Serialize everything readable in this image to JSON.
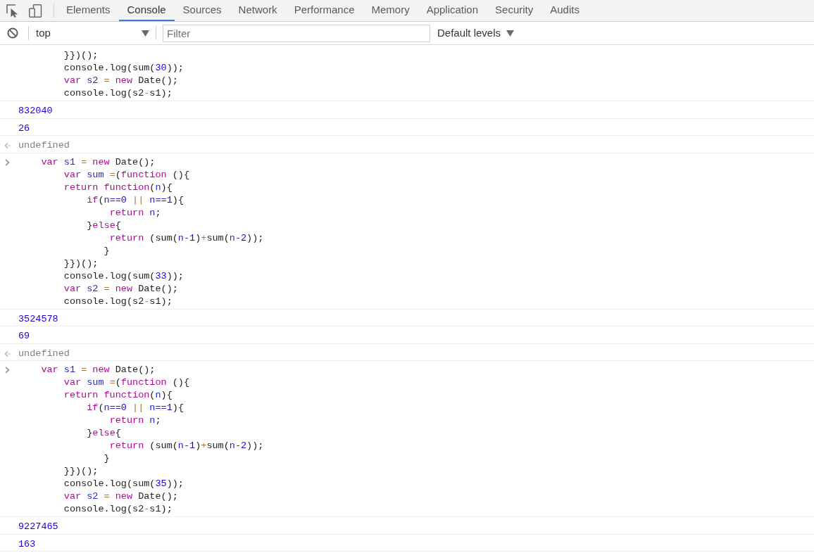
{
  "tabs": [
    {
      "label": "Elements",
      "selected": false
    },
    {
      "label": "Console",
      "selected": true
    },
    {
      "label": "Sources",
      "selected": false
    },
    {
      "label": "Network",
      "selected": false
    },
    {
      "label": "Performance",
      "selected": false
    },
    {
      "label": "Memory",
      "selected": false
    },
    {
      "label": "Application",
      "selected": false
    },
    {
      "label": "Security",
      "selected": false
    },
    {
      "label": "Audits",
      "selected": false
    }
  ],
  "console_toolbar": {
    "context": "top",
    "filter": {
      "placeholder": "Filter"
    },
    "levels": "Default levels"
  },
  "messages": [
    {
      "kind": "continuation",
      "lines": [
        {
          "tokens": [
            {
              "kind": "plain",
              "text": "        }})();"
            }
          ]
        },
        {
          "tokens": [
            {
              "kind": "plain",
              "text": "        console.log(sum("
            },
            {
              "kind": "number",
              "text": "30"
            },
            {
              "kind": "plain",
              "text": "));"
            }
          ]
        },
        {
          "tokens": [
            {
              "kind": "keyword",
              "text": "        var "
            },
            {
              "kind": "name",
              "text": "s2 "
            },
            {
              "kind": "operator",
              "text": "= "
            },
            {
              "kind": "keyword",
              "text": "new "
            },
            {
              "kind": "plain",
              "text": "Date();"
            }
          ]
        },
        {
          "tokens": [
            {
              "kind": "plain",
              "text": "        console.log(s2"
            },
            {
              "kind": "operator",
              "text": "-"
            },
            {
              "kind": "plain",
              "text": "s1);"
            }
          ]
        }
      ]
    },
    {
      "kind": "output",
      "text": "832040"
    },
    {
      "kind": "output",
      "text": "26"
    },
    {
      "kind": "result",
      "text": "undefined"
    },
    {
      "kind": "input",
      "lines": [
        {
          "tokens": [
            {
              "kind": "keyword",
              "text": "    var "
            },
            {
              "kind": "name",
              "text": "s1 "
            },
            {
              "kind": "operator",
              "text": "= "
            },
            {
              "kind": "keyword",
              "text": "new "
            },
            {
              "kind": "plain",
              "text": "Date();"
            }
          ]
        },
        {
          "tokens": [
            {
              "kind": "keyword",
              "text": "        var "
            },
            {
              "kind": "name",
              "text": "sum "
            },
            {
              "kind": "operator",
              "text": "="
            },
            {
              "kind": "plain",
              "text": "("
            },
            {
              "kind": "keyword",
              "text": "function "
            },
            {
              "kind": "plain",
              "text": "(){"
            }
          ]
        },
        {
          "tokens": [
            {
              "kind": "keyword",
              "text": "        return function"
            },
            {
              "kind": "plain",
              "text": "("
            },
            {
              "kind": "name",
              "text": "n"
            },
            {
              "kind": "plain",
              "text": "){"
            }
          ]
        },
        {
          "tokens": [
            {
              "kind": "keyword",
              "text": "            if"
            },
            {
              "kind": "plain",
              "text": "("
            },
            {
              "kind": "name",
              "text": "n=="
            },
            {
              "kind": "number",
              "text": "0"
            },
            {
              "kind": "operator",
              "text": " || "
            },
            {
              "kind": "name",
              "text": "n=="
            },
            {
              "kind": "number",
              "text": "1"
            },
            {
              "kind": "plain",
              "text": "){"
            }
          ]
        },
        {
          "tokens": [
            {
              "kind": "keyword",
              "text": "                return "
            },
            {
              "kind": "name",
              "text": "n"
            },
            {
              "kind": "plain",
              "text": ";"
            }
          ]
        },
        {
          "tokens": [
            {
              "kind": "plain",
              "text": "            }"
            },
            {
              "kind": "keyword",
              "text": "else"
            },
            {
              "kind": "plain",
              "text": "{"
            }
          ]
        },
        {
          "tokens": [
            {
              "kind": "keyword",
              "text": "                return "
            },
            {
              "kind": "plain",
              "text": "(sum("
            },
            {
              "kind": "name",
              "text": "n-"
            },
            {
              "kind": "number",
              "text": "1"
            },
            {
              "kind": "plain",
              "text": ")"
            },
            {
              "kind": "operator",
              "text": "+"
            },
            {
              "kind": "plain",
              "text": "sum("
            },
            {
              "kind": "name",
              "text": "n-"
            },
            {
              "kind": "number",
              "text": "2"
            },
            {
              "kind": "plain",
              "text": "));"
            }
          ]
        },
        {
          "tokens": [
            {
              "kind": "plain",
              "text": "               }"
            }
          ]
        },
        {
          "tokens": [
            {
              "kind": "plain",
              "text": "        }})();"
            }
          ]
        },
        {
          "tokens": [
            {
              "kind": "plain",
              "text": "        console.log(sum("
            },
            {
              "kind": "number",
              "text": "33"
            },
            {
              "kind": "plain",
              "text": "));"
            }
          ]
        },
        {
          "tokens": [
            {
              "kind": "keyword",
              "text": "        var "
            },
            {
              "kind": "name",
              "text": "s2 "
            },
            {
              "kind": "operator",
              "text": "= "
            },
            {
              "kind": "keyword",
              "text": "new "
            },
            {
              "kind": "plain",
              "text": "Date();"
            }
          ]
        },
        {
          "tokens": [
            {
              "kind": "plain",
              "text": "        console.log(s2"
            },
            {
              "kind": "operator",
              "text": "-"
            },
            {
              "kind": "plain",
              "text": "s1);"
            }
          ]
        }
      ]
    },
    {
      "kind": "output",
      "text": "3524578"
    },
    {
      "kind": "output",
      "text": "69"
    },
    {
      "kind": "result",
      "text": "undefined"
    },
    {
      "kind": "input",
      "lines": [
        {
          "tokens": [
            {
              "kind": "keyword",
              "text": "    var "
            },
            {
              "kind": "name",
              "text": "s1 "
            },
            {
              "kind": "operator",
              "text": "= "
            },
            {
              "kind": "keyword",
              "text": "new "
            },
            {
              "kind": "plain",
              "text": "Date();"
            }
          ]
        },
        {
          "tokens": [
            {
              "kind": "keyword",
              "text": "        var "
            },
            {
              "kind": "name",
              "text": "sum "
            },
            {
              "kind": "operator",
              "text": "="
            },
            {
              "kind": "plain",
              "text": "("
            },
            {
              "kind": "keyword",
              "text": "function "
            },
            {
              "kind": "plain",
              "text": "(){"
            }
          ]
        },
        {
          "tokens": [
            {
              "kind": "keyword",
              "text": "        return function"
            },
            {
              "kind": "plain",
              "text": "("
            },
            {
              "kind": "name",
              "text": "n"
            },
            {
              "kind": "plain",
              "text": "){"
            }
          ]
        },
        {
          "tokens": [
            {
              "kind": "keyword",
              "text": "            if"
            },
            {
              "kind": "plain",
              "text": "("
            },
            {
              "kind": "name",
              "text": "n=="
            },
            {
              "kind": "number",
              "text": "0"
            },
            {
              "kind": "operator",
              "text": " || "
            },
            {
              "kind": "name",
              "text": "n=="
            },
            {
              "kind": "number",
              "text": "1"
            },
            {
              "kind": "plain",
              "text": "){"
            }
          ]
        },
        {
          "tokens": [
            {
              "kind": "keyword",
              "text": "                return "
            },
            {
              "kind": "name",
              "text": "n"
            },
            {
              "kind": "plain",
              "text": ";"
            }
          ]
        },
        {
          "tokens": [
            {
              "kind": "plain",
              "text": "            }"
            },
            {
              "kind": "keyword",
              "text": "else"
            },
            {
              "kind": "plain",
              "text": "{"
            }
          ]
        },
        {
          "tokens": [
            {
              "kind": "keyword",
              "text": "                return "
            },
            {
              "kind": "plain",
              "text": "(sum("
            },
            {
              "kind": "name",
              "text": "n-"
            },
            {
              "kind": "number",
              "text": "1"
            },
            {
              "kind": "plain",
              "text": ")"
            },
            {
              "kind": "operator",
              "text": "+"
            },
            {
              "kind": "plain",
              "text": "sum("
            },
            {
              "kind": "name",
              "text": "n-"
            },
            {
              "kind": "number",
              "text": "2"
            },
            {
              "kind": "plain",
              "text": "));"
            }
          ]
        },
        {
          "tokens": [
            {
              "kind": "plain",
              "text": "               }"
            }
          ]
        },
        {
          "tokens": [
            {
              "kind": "plain",
              "text": "        }})();"
            }
          ]
        },
        {
          "tokens": [
            {
              "kind": "plain",
              "text": "        console.log(sum("
            },
            {
              "kind": "number",
              "text": "35"
            },
            {
              "kind": "plain",
              "text": "));"
            }
          ]
        },
        {
          "tokens": [
            {
              "kind": "keyword",
              "text": "        var "
            },
            {
              "kind": "name",
              "text": "s2 "
            },
            {
              "kind": "operator",
              "text": "= "
            },
            {
              "kind": "keyword",
              "text": "new "
            },
            {
              "kind": "plain",
              "text": "Date();"
            }
          ]
        },
        {
          "tokens": [
            {
              "kind": "plain",
              "text": "        console.log(s2"
            },
            {
              "kind": "operator",
              "text": "-"
            },
            {
              "kind": "plain",
              "text": "s1);"
            }
          ]
        }
      ]
    },
    {
      "kind": "output",
      "text": "9227465"
    },
    {
      "kind": "output",
      "text": "163"
    }
  ]
}
